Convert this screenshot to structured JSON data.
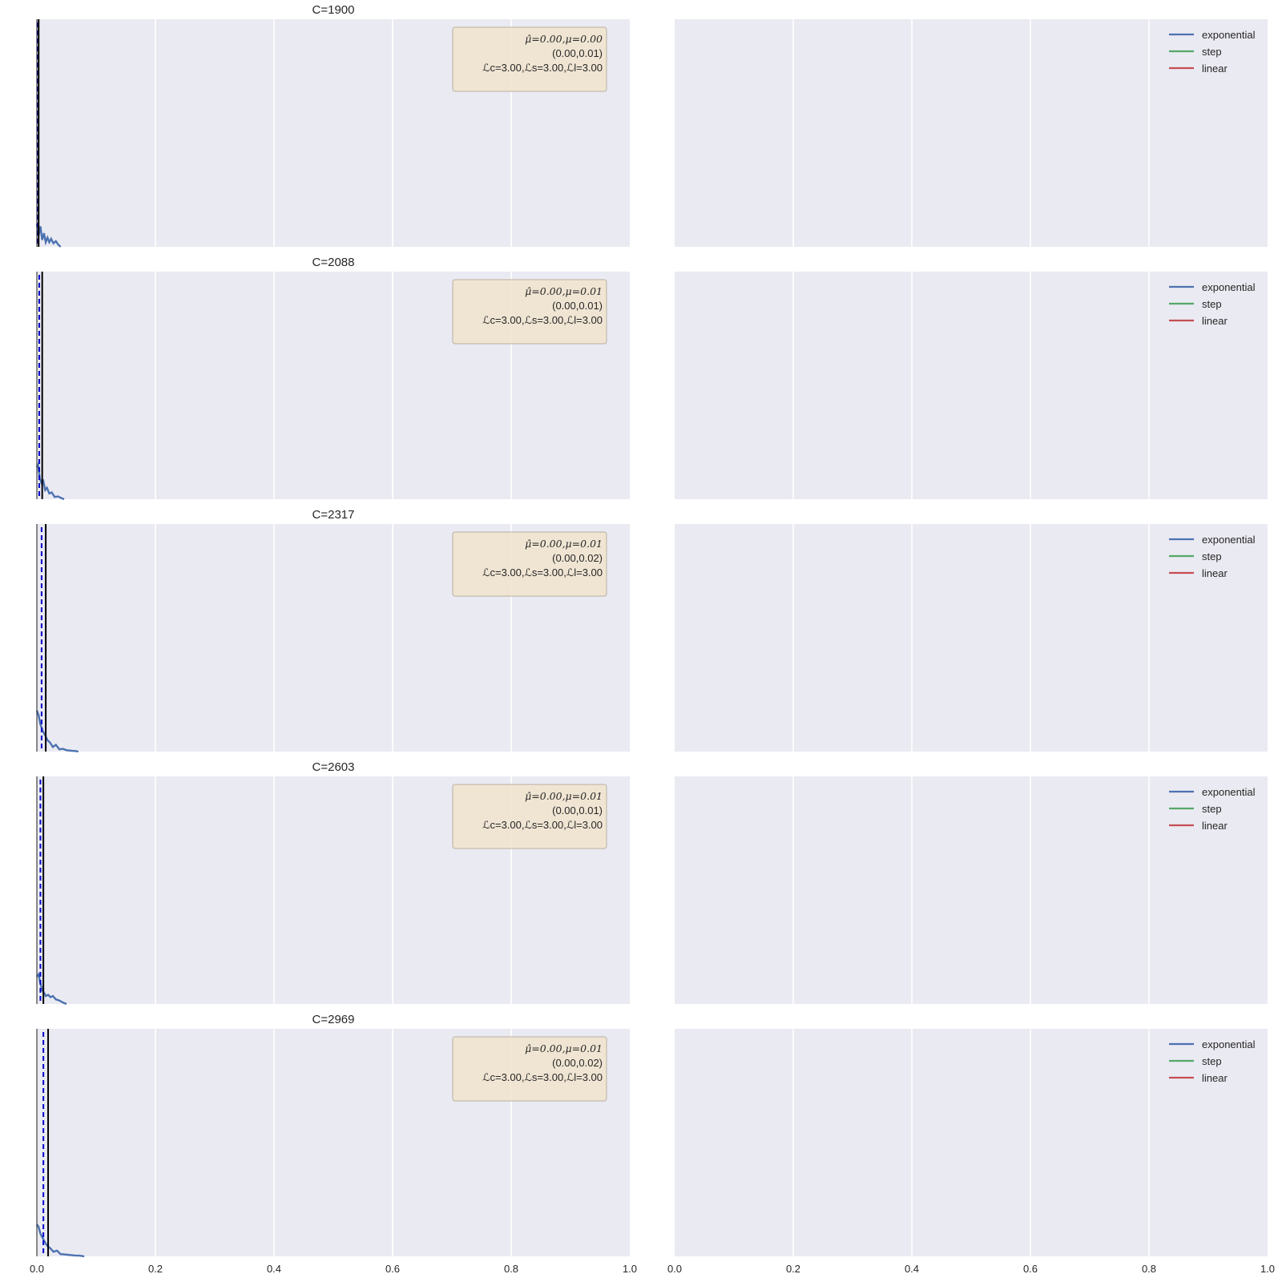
{
  "chart_data": {
    "type": "line",
    "xlim": [
      0,
      1
    ],
    "x_ticks": [
      "0.0",
      "0.2",
      "0.4",
      "0.6",
      "0.8",
      "1.0"
    ],
    "grid": true,
    "legend": {
      "placement": "top-right",
      "entries": [
        {
          "label": "exponential",
          "color": "#4c72b0"
        },
        {
          "label": "step",
          "color": "#55a868"
        },
        {
          "label": "linear",
          "color": "#c44e52"
        }
      ]
    },
    "rows": [
      {
        "title": "C=1900",
        "annotation": {
          "line1": "μ̂=0.00,μ=0.00",
          "line2": "(0.00,0.01)",
          "line3": "ℒc=3.00,ℒs=3.00,ℒl=3.00"
        },
        "vline_solid": 0.003,
        "vline_dashed": 0.002,
        "density": {
          "x": [
            0.0,
            0.003,
            0.006,
            0.009,
            0.012,
            0.015,
            0.018,
            0.021,
            0.024,
            0.028,
            0.032,
            0.036,
            0.04
          ],
          "y": [
            0.1,
            0.05,
            0.09,
            0.03,
            0.06,
            0.02,
            0.04,
            0.02,
            0.035,
            0.015,
            0.025,
            0.01,
            0.0
          ]
        }
      },
      {
        "title": "C=2088",
        "annotation": {
          "line1": "μ̂=0.00,μ=0.01",
          "line2": "(0.00,0.01)",
          "line3": "ℒc=3.00,ℒs=3.00,ℒl=3.00"
        },
        "vline_solid": 0.009,
        "vline_dashed": 0.004,
        "density": {
          "x": [
            0.0,
            0.002,
            0.005,
            0.008,
            0.011,
            0.014,
            0.017,
            0.021,
            0.025,
            0.03,
            0.036,
            0.042,
            0.046
          ],
          "y": [
            0.14,
            0.15,
            0.09,
            0.07,
            0.08,
            0.04,
            0.05,
            0.025,
            0.03,
            0.01,
            0.012,
            0.004,
            0.0
          ]
        }
      },
      {
        "title": "C=2317",
        "annotation": {
          "line1": "μ̂=0.00,μ=0.01",
          "line2": "(0.00,0.02)",
          "line3": "ℒc=3.00,ℒs=3.00,ℒl=3.00"
        },
        "vline_solid": 0.015,
        "vline_dashed": 0.008,
        "density": {
          "x": [
            0.0,
            0.003,
            0.006,
            0.01,
            0.014,
            0.018,
            0.022,
            0.027,
            0.032,
            0.038,
            0.044,
            0.05,
            0.058,
            0.066,
            0.07
          ],
          "y": [
            0.18,
            0.16,
            0.12,
            0.09,
            0.07,
            0.05,
            0.04,
            0.02,
            0.03,
            0.01,
            0.012,
            0.006,
            0.004,
            0.002,
            0.0
          ]
        }
      },
      {
        "title": "C=2603",
        "annotation": {
          "line1": "μ̂=0.00,μ=0.01",
          "line2": "(0.00,0.01)",
          "line3": "ℒc=3.00,ℒs=3.00,ℒl=3.00"
        },
        "vline_solid": 0.011,
        "vline_dashed": 0.006,
        "density": {
          "x": [
            0.0,
            0.003,
            0.006,
            0.009,
            0.012,
            0.015,
            0.019,
            0.023,
            0.027,
            0.032,
            0.038,
            0.044,
            0.05
          ],
          "y": [
            0.12,
            0.13,
            0.09,
            0.06,
            0.05,
            0.035,
            0.04,
            0.03,
            0.035,
            0.02,
            0.015,
            0.006,
            0.0
          ]
        }
      },
      {
        "title": "C=2969",
        "annotation": {
          "line1": "μ̂=0.00,μ=0.01",
          "line2": "(0.00,0.02)",
          "line3": "ℒc=3.00,ℒs=3.00,ℒl=3.00"
        },
        "vline_solid": 0.019,
        "vline_dashed": 0.011,
        "density": {
          "x": [
            0.0,
            0.003,
            0.006,
            0.01,
            0.014,
            0.018,
            0.023,
            0.028,
            0.034,
            0.04,
            0.048,
            0.056,
            0.064,
            0.072,
            0.08
          ],
          "y": [
            0.14,
            0.13,
            0.1,
            0.08,
            0.06,
            0.045,
            0.035,
            0.02,
            0.025,
            0.01,
            0.008,
            0.006,
            0.004,
            0.003,
            0.0
          ]
        }
      }
    ]
  }
}
